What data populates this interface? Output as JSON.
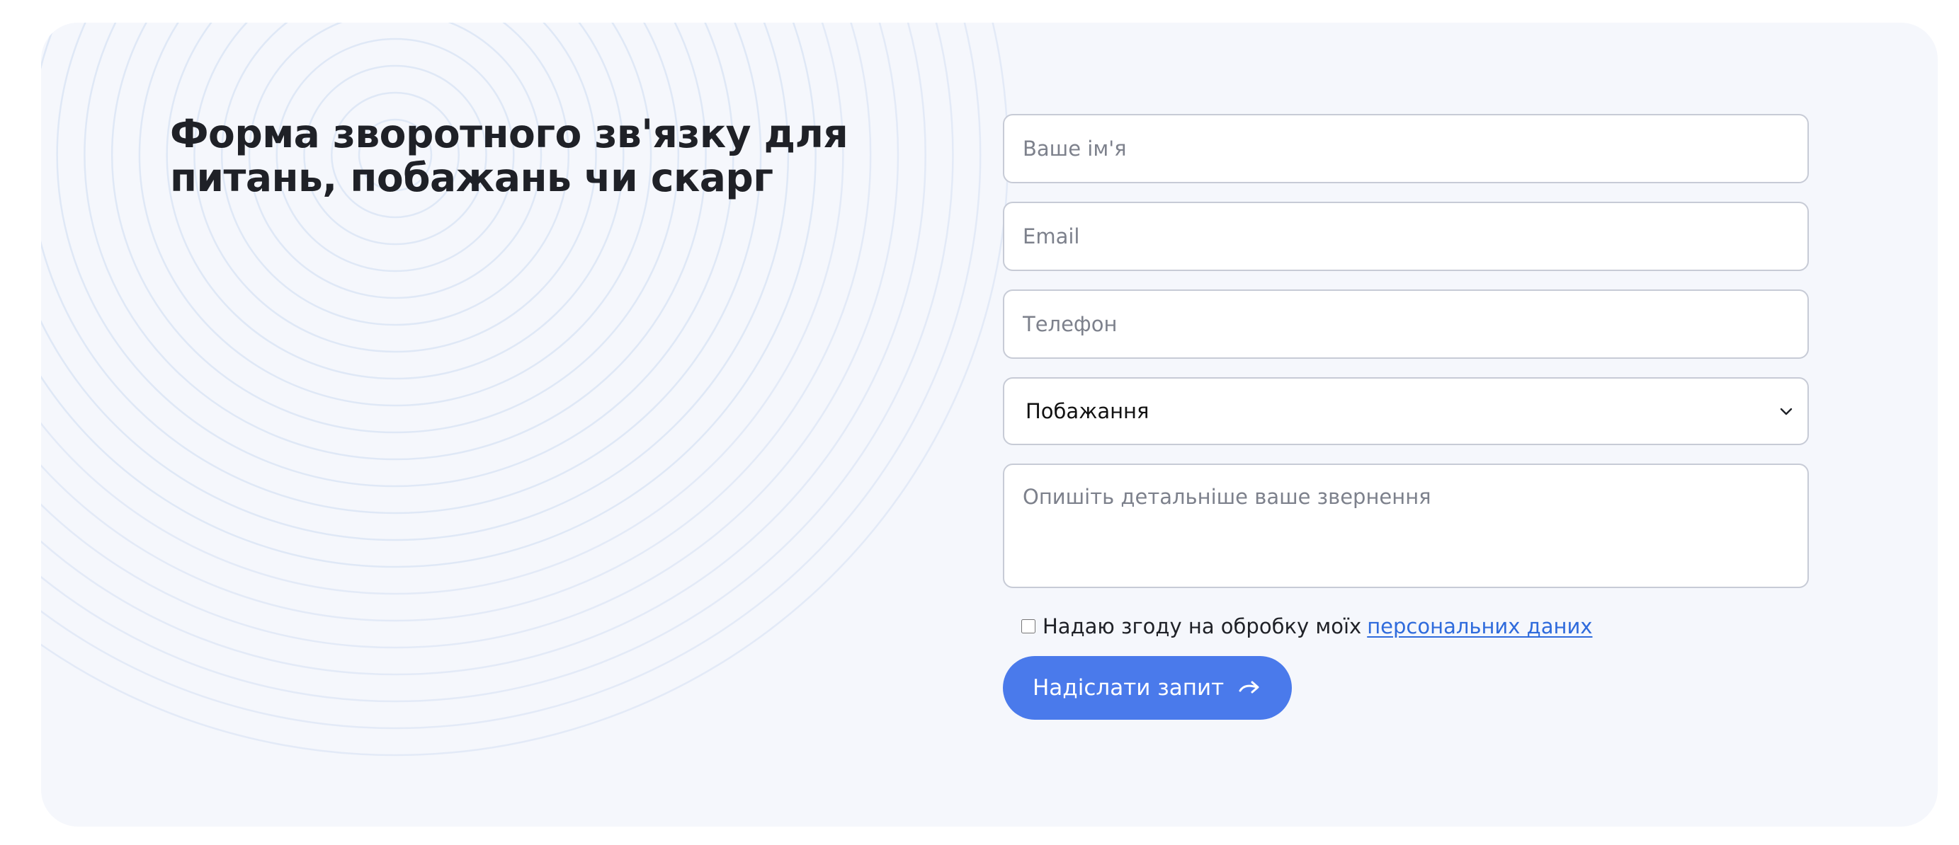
{
  "title": "Форма зворотного зв'язку для питань, побажань чи скарг",
  "form": {
    "name_placeholder": "Ваше ім'я",
    "email_placeholder": "Email",
    "phone_placeholder": "Телефон",
    "topic_selected": "Побажання",
    "message_placeholder": "Опишіть детальніше ваше звернення",
    "consent_text": "Надаю згоду на обробку моїх",
    "consent_link": "персональних даних",
    "submit_label": "Надіслати запит",
    "submit_icon": "arrow-right-icon",
    "select_icon": "chevron-down-icon"
  },
  "colors": {
    "card_background": "#f5f7fc",
    "accent": "#4a7aeb",
    "link": "#2f6bdc",
    "ring": "#dfe8f6"
  }
}
